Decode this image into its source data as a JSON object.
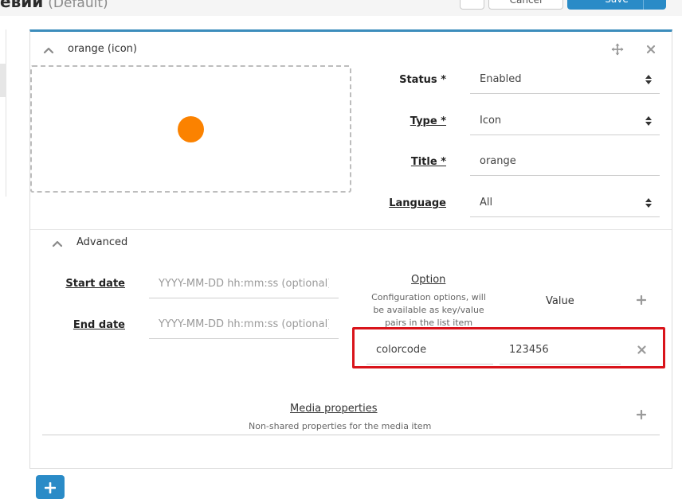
{
  "header": {
    "title": "евии",
    "title_suffix": "(Default)",
    "small_button_label": "+",
    "cancel_label": "Cancel",
    "save_label": "Save"
  },
  "item": {
    "title": "orange (icon)",
    "icon_color": "#fb8200"
  },
  "form": {
    "status_label": "Status *",
    "status_value": "Enabled",
    "type_label": "Type *",
    "type_value": "Icon",
    "title_label": "Title *",
    "title_value": "orange",
    "language_label": "Language",
    "language_value": "All"
  },
  "advanced": {
    "title": "Advanced",
    "start_label": "Start date",
    "start_placeholder": "YYYY-MM-DD hh:mm:ss (optional)",
    "end_label": "End date",
    "end_placeholder": "YYYY-MM-DD hh:mm:ss (optional)",
    "option_title": "Option",
    "option_desc": "Configuration options, will be available as key/value pairs in the list item",
    "value_title": "Value",
    "option_key": "colorcode",
    "option_value": "123456"
  },
  "media": {
    "title": "Media properties",
    "desc": "Non-shared properties for the media item"
  },
  "colors": {
    "accent": "#3c8dbc",
    "button": "#2a8bc7",
    "highlight": "#d9141b"
  }
}
